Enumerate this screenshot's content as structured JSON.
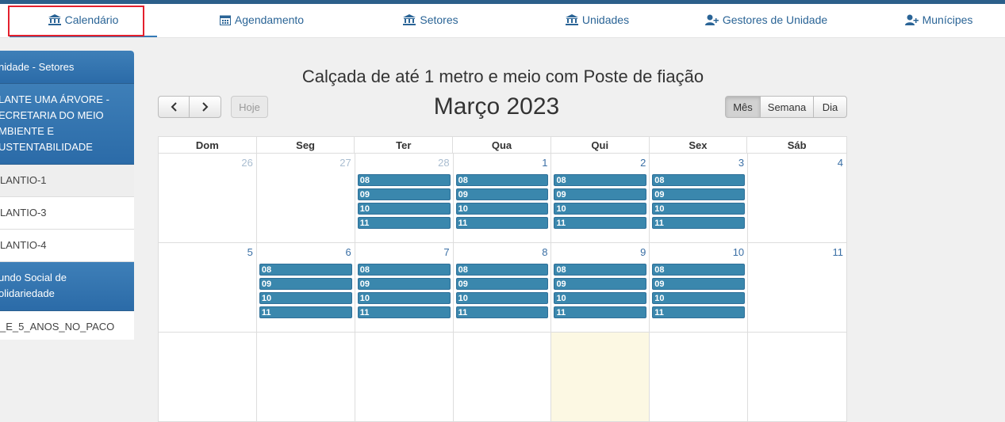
{
  "nav": {
    "items": [
      {
        "label": "Calendário",
        "icon": "bank-icon",
        "active": true
      },
      {
        "label": "Agendamento",
        "icon": "calendar-icon"
      },
      {
        "label": "Setores",
        "icon": "bank-icon"
      },
      {
        "label": "Unidades",
        "icon": "bank-icon"
      },
      {
        "label": "Gestores de Unidade",
        "icon": "user-plus-icon"
      },
      {
        "label": "Munícipes",
        "icon": "user-plus-icon"
      }
    ]
  },
  "sidebar": {
    "group1_title": "nidade - Setores",
    "group2_title": "LANTE UMA ÁRVORE -\nECRETARIA DO MEIO\nMBIENTE E\nUSTENTABILIDADE",
    "items1": [
      "LANTIO-1",
      "LANTIO-3",
      "LANTIO-4"
    ],
    "group3_title": "undo Social de\nolidariedade",
    "items2": [
      "_E_5_ANOS_NO_PACO"
    ]
  },
  "calendar": {
    "page_title": "Calçada de até 1 metro e meio com Poste de fiação",
    "month_title": "Março 2023",
    "today_label": "Hoje",
    "prev_label": "‹",
    "next_label": "›",
    "views": {
      "month": "Mês",
      "week": "Semana",
      "day": "Dia"
    },
    "weekdays": [
      "Dom",
      "Seg",
      "Ter",
      "Qua",
      "Qui",
      "Sex",
      "Sáb"
    ],
    "weeks": [
      [
        {
          "day": "26",
          "other": true,
          "events": []
        },
        {
          "day": "27",
          "other": true,
          "events": []
        },
        {
          "day": "28",
          "other": true,
          "events": [
            "08",
            "09",
            "10",
            "11"
          ]
        },
        {
          "day": "1",
          "events": [
            "08",
            "09",
            "10",
            "11"
          ]
        },
        {
          "day": "2",
          "events": [
            "08",
            "09",
            "10",
            "11"
          ]
        },
        {
          "day": "3",
          "events": [
            "08",
            "09",
            "10",
            "11"
          ]
        },
        {
          "day": "4",
          "events": []
        }
      ],
      [
        {
          "day": "5",
          "events": []
        },
        {
          "day": "6",
          "events": [
            "08",
            "09",
            "10",
            "11"
          ]
        },
        {
          "day": "7",
          "events": [
            "08",
            "09",
            "10",
            "11"
          ]
        },
        {
          "day": "8",
          "events": [
            "08",
            "09",
            "10",
            "11"
          ]
        },
        {
          "day": "9",
          "events": [
            "08",
            "09",
            "10",
            "11"
          ]
        },
        {
          "day": "10",
          "events": [
            "08",
            "09",
            "10",
            "11"
          ]
        },
        {
          "day": "11",
          "events": []
        }
      ],
      [
        {
          "day": "",
          "events": []
        },
        {
          "day": "",
          "events": []
        },
        {
          "day": "",
          "events": []
        },
        {
          "day": "",
          "events": []
        },
        {
          "day": "",
          "today": true,
          "events": []
        },
        {
          "day": "",
          "events": []
        },
        {
          "day": "",
          "events": []
        }
      ]
    ]
  }
}
